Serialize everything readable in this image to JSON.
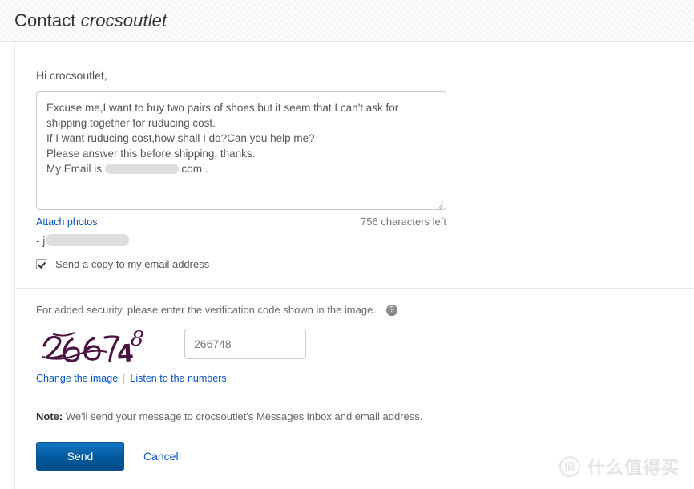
{
  "header": {
    "title_prefix": "Contact",
    "shop_name": "crocsoutlet"
  },
  "form": {
    "greeting": "Hi crocsoutlet,",
    "message_lines": [
      "Excuse me,I want to buy two pairs of shoes,but it seem that I can't ask for",
      "shipping together for ruducing cost.",
      "If I want ruducing cost,how shall I do?Can you help me?",
      "Please answer this before shipping, thanks."
    ],
    "message_email_prefix": "My Email is",
    "message_email_suffix": ".com .",
    "attach_photos_label": "Attach photos",
    "characters_left": "756 characters left",
    "signature_prefix": "- j",
    "send_copy_label": "Send a copy to my email address",
    "send_copy_checked": true
  },
  "security": {
    "instruction": "For added security, please enter the verification code shown in the image.",
    "help_icon_glyph": "?",
    "captcha_code": "266748",
    "captcha_input_value": "266748",
    "change_image_label": "Change the image",
    "separator": "|",
    "listen_label": "Listen to the numbers",
    "captcha_ink_color": "#4b1242"
  },
  "note": {
    "label": "Note:",
    "text": "We'll send your message to crocsoutlet's Messages inbox and email address."
  },
  "actions": {
    "send_label": "Send",
    "cancel_label": "Cancel",
    "send_button_color": "#045a9e",
    "link_color": "#0654ba"
  },
  "watermark": {
    "logo_glyph": "值",
    "text": "什么值得买"
  }
}
